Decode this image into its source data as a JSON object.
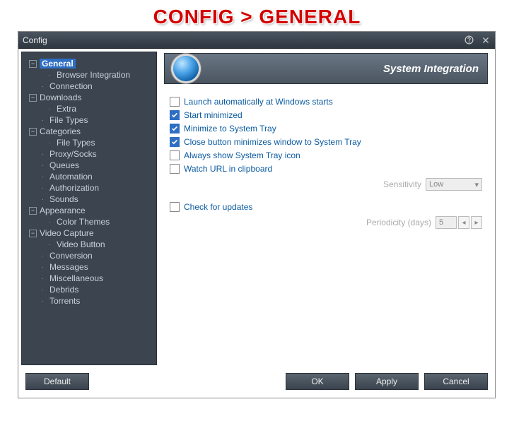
{
  "banner": "CONFIG > GENERAL",
  "window": {
    "title": "Config"
  },
  "sidebar": {
    "items": [
      {
        "label": "General",
        "type": "top",
        "expanded": true,
        "selected": true
      },
      {
        "label": "Browser Integration",
        "type": "child"
      },
      {
        "label": "Connection",
        "type": "child2"
      },
      {
        "label": "Downloads",
        "type": "top",
        "expanded": true
      },
      {
        "label": "Extra",
        "type": "child"
      },
      {
        "label": "File Types",
        "type": "child2"
      },
      {
        "label": "Categories",
        "type": "top",
        "expanded": true
      },
      {
        "label": "File Types",
        "type": "child"
      },
      {
        "label": "Proxy/Socks",
        "type": "child2"
      },
      {
        "label": "Queues",
        "type": "child2"
      },
      {
        "label": "Automation",
        "type": "child2"
      },
      {
        "label": "Authorization",
        "type": "child2"
      },
      {
        "label": "Sounds",
        "type": "child2"
      },
      {
        "label": "Appearance",
        "type": "top",
        "expanded": true
      },
      {
        "label": "Color Themes",
        "type": "child"
      },
      {
        "label": "Video Capture",
        "type": "top",
        "expanded": true
      },
      {
        "label": "Video Button",
        "type": "child"
      },
      {
        "label": "Conversion",
        "type": "child2"
      },
      {
        "label": "Messages",
        "type": "child2"
      },
      {
        "label": "Miscellaneous",
        "type": "child2"
      },
      {
        "label": "Debrids",
        "type": "child2"
      },
      {
        "label": "Torrents",
        "type": "child2"
      }
    ]
  },
  "section": {
    "title": "System Integration"
  },
  "options": {
    "launch_at_start": {
      "label": "Launch automatically at Windows starts",
      "checked": false
    },
    "start_minimized": {
      "label": "Start minimized",
      "checked": true
    },
    "minimize_tray": {
      "label": "Minimize to System Tray",
      "checked": true
    },
    "close_to_tray": {
      "label": "Close button minimizes window to System Tray",
      "checked": true
    },
    "always_tray_icon": {
      "label": "Always show System Tray icon",
      "checked": false
    },
    "watch_clipboard": {
      "label": "Watch URL in clipboard",
      "checked": false
    },
    "check_updates": {
      "label": "Check for updates",
      "checked": false
    }
  },
  "sensitivity": {
    "label": "Sensitivity",
    "value": "Low"
  },
  "periodicity": {
    "label": "Periodicity (days)",
    "value": "5"
  },
  "buttons": {
    "default": "Default",
    "ok": "OK",
    "apply": "Apply",
    "cancel": "Cancel"
  }
}
